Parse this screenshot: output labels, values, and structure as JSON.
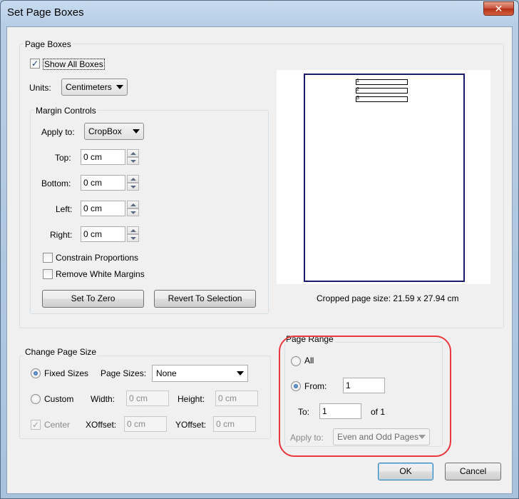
{
  "window": {
    "title": "Set Page Boxes",
    "close_glyph": "✕"
  },
  "page_boxes": {
    "group_title": "Page Boxes",
    "show_all_boxes": {
      "label": "Show All Boxes",
      "checked": true
    },
    "units": {
      "label": "Units:",
      "value": "Centimeters"
    },
    "margin_controls": {
      "group_title": "Margin Controls",
      "apply_to": {
        "label": "Apply to:",
        "value": "CropBox"
      },
      "top": {
        "label": "Top:",
        "value": "0 cm"
      },
      "bottom": {
        "label": "Bottom:",
        "value": "0 cm"
      },
      "left": {
        "label": "Left:",
        "value": "0 cm"
      },
      "right": {
        "label": "Right:",
        "value": "0 cm"
      },
      "constrain_proportions": {
        "label": "Constrain Proportions",
        "checked": false
      },
      "remove_white_margins": {
        "label": "Remove White Margins",
        "checked": false
      },
      "set_to_zero_label": "Set To Zero",
      "revert_to_selection_label": "Revert To Selection"
    },
    "preview": {
      "row_numbers": [
        "1",
        "2",
        "3"
      ],
      "cropped_size": "Cropped page size: 21.59 x 27.94 cm"
    }
  },
  "change_page_size": {
    "group_title": "Change Page Size",
    "fixed_sizes": {
      "label": "Fixed Sizes",
      "selected": true
    },
    "page_sizes": {
      "label": "Page Sizes:",
      "value": "None"
    },
    "custom": {
      "label": "Custom",
      "selected": false
    },
    "width": {
      "label": "Width:",
      "value": "0 cm"
    },
    "height": {
      "label": "Height:",
      "value": "0 cm"
    },
    "center": {
      "label": "Center",
      "checked": true,
      "enabled": false
    },
    "xoffset": {
      "label": "XOffset:",
      "value": "0 cm"
    },
    "yoffset": {
      "label": "YOffset:",
      "value": "0 cm"
    }
  },
  "page_range": {
    "group_title": "Page Range",
    "all": {
      "label": "All",
      "selected": false
    },
    "from": {
      "label": "From:",
      "value": "1",
      "selected": true
    },
    "to": {
      "label": "To:",
      "value": "1"
    },
    "of_label": "of 1",
    "apply_to": {
      "label": "Apply to:",
      "value": "Even and Odd Pages"
    }
  },
  "buttons": {
    "ok": "OK",
    "cancel": "Cancel"
  },
  "colors": {
    "annotation": "#e8383d",
    "page_border": "#1a1a6e",
    "window_frame": "#b6cde6"
  }
}
